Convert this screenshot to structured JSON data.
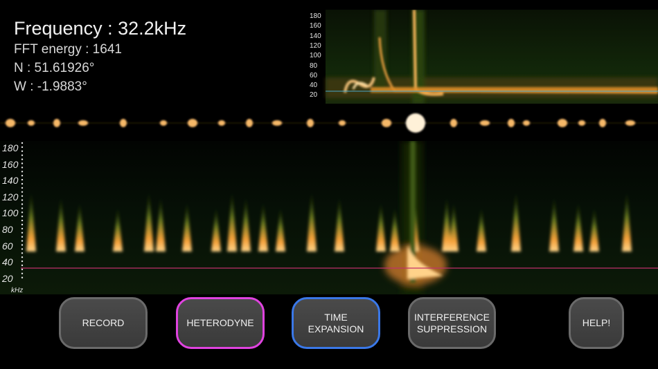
{
  "readout": {
    "frequency": "Frequency : 32.2kHz",
    "fft_energy": "FFT energy : 1641",
    "latitude": "N  : 51.61926°",
    "longitude": "W : -1.9883°"
  },
  "zoom_axis": {
    "ticks": [
      "180",
      "160",
      "140",
      "120",
      "100",
      "80",
      "60",
      "40",
      "20"
    ]
  },
  "main_axis": {
    "ticks": [
      "180",
      "160",
      "140",
      "120",
      "100",
      "80",
      "60",
      "40",
      "20"
    ],
    "unit": "kHz"
  },
  "controls": {
    "record": "RECORD",
    "heterodyne": "HETERODYNE",
    "time_expansion_1": "TIME",
    "time_expansion_2": "EXPANSION",
    "interference_1": "INTERFERENCE",
    "interference_2": "SUPPRESSION",
    "help": "HELP!"
  },
  "colors": {
    "heterodyne_accent": "#e043e0",
    "time_expansion_accent": "#3a78e8",
    "marker_line": "#c0306a"
  }
}
